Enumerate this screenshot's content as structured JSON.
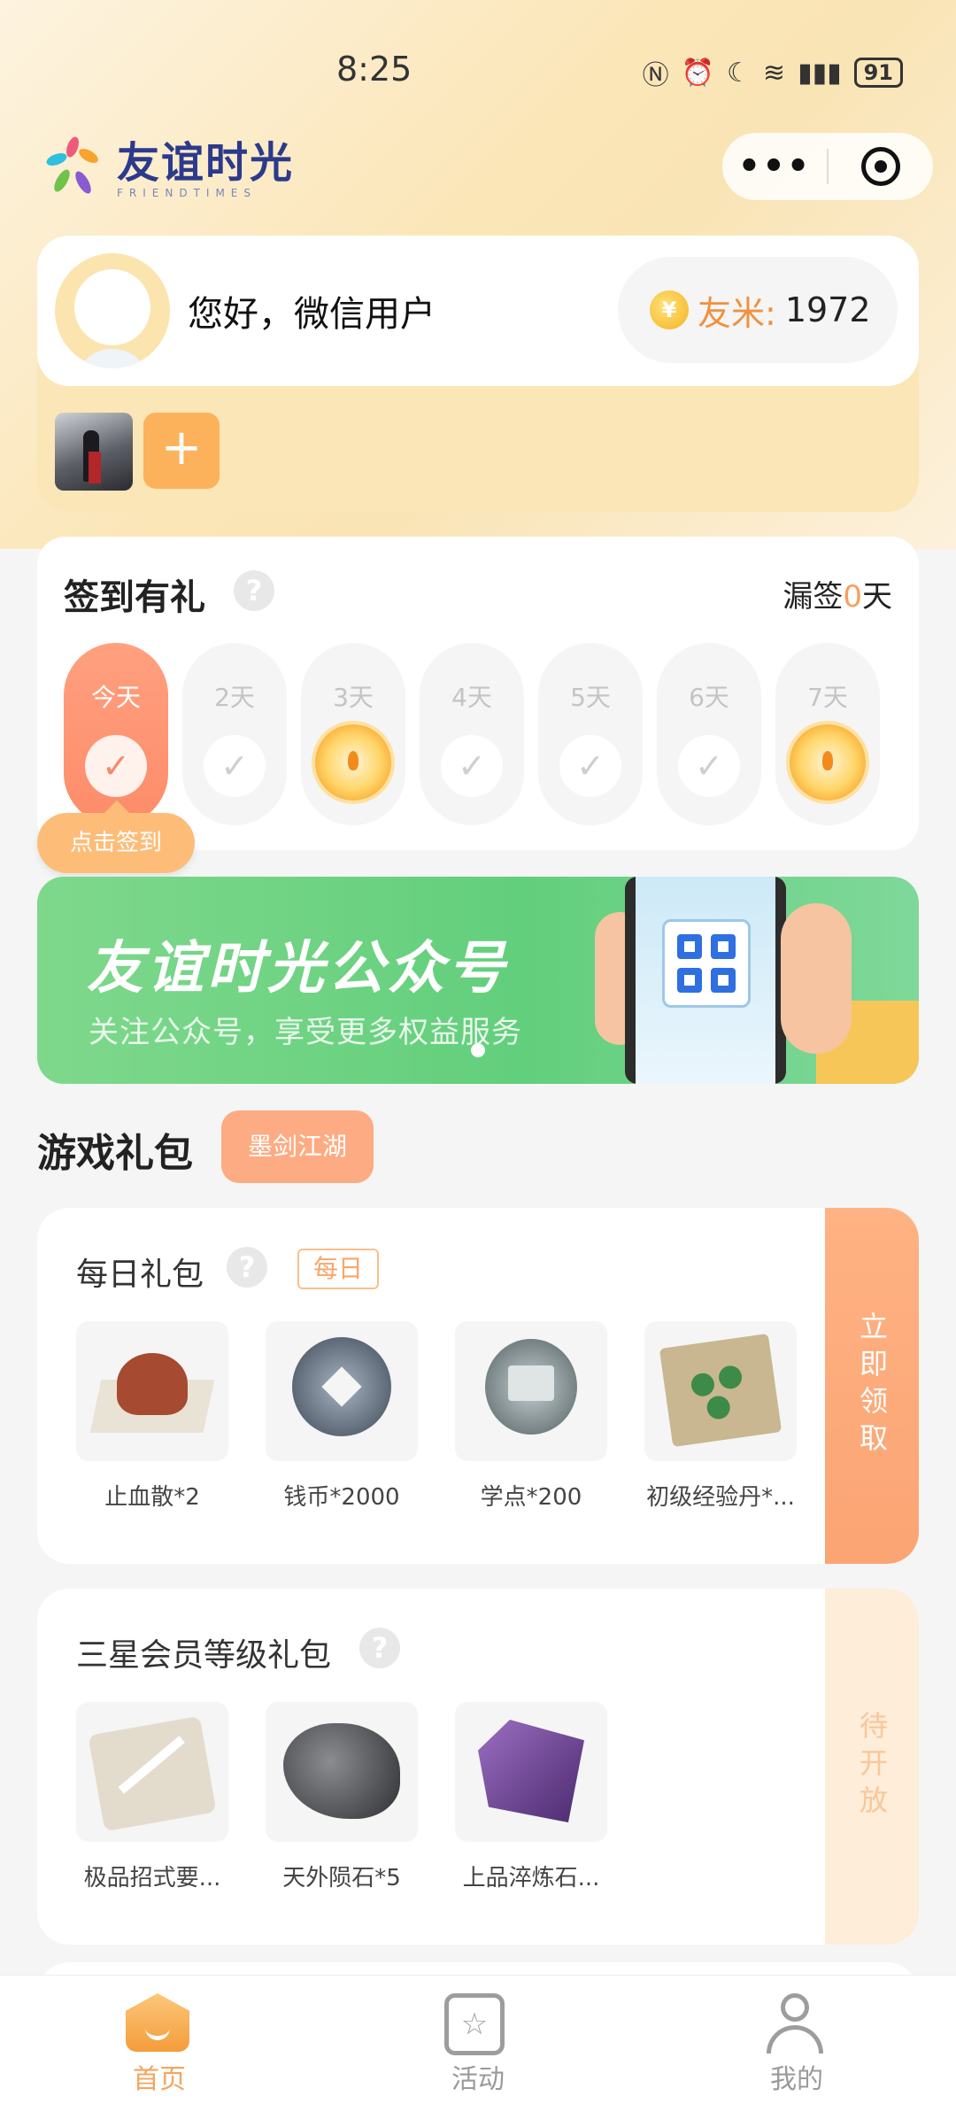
{
  "status_bar": {
    "time": "8:25",
    "icons": [
      "nfc-icon",
      "alarm-icon",
      "moon-icon",
      "wifi-icon",
      "signal-5g-icon"
    ],
    "battery": "91"
  },
  "header": {
    "logo_text": "友谊时光",
    "logo_sub": "FRIENDTIMES"
  },
  "user": {
    "greeting": "您好，微信用户",
    "coin_label": "友米:",
    "coin_value": "1972"
  },
  "signin": {
    "title": "签到有礼",
    "missed_prefix": "漏签",
    "missed_count": "0",
    "missed_suffix": "天",
    "days": [
      {
        "label": "今天",
        "state": "today"
      },
      {
        "label": "2天",
        "state": "check"
      },
      {
        "label": "3天",
        "state": "prize"
      },
      {
        "label": "4天",
        "state": "check"
      },
      {
        "label": "5天",
        "state": "check"
      },
      {
        "label": "6天",
        "state": "check"
      },
      {
        "label": "7天",
        "state": "prize"
      }
    ],
    "tip": "点击签到"
  },
  "banner": {
    "title": "友谊时光公众号",
    "subtitle": "关注公众号，享受更多权益服务"
  },
  "gifts": {
    "section_title": "游戏礼包",
    "game_chip": "墨剑江湖",
    "daily": {
      "title": "每日礼包",
      "tag": "每日",
      "action": "立即领取",
      "items": [
        {
          "name": "止血散*2"
        },
        {
          "name": "钱币*2000"
        },
        {
          "name": "学点*200"
        },
        {
          "name": "初级经验丹*..."
        }
      ]
    },
    "member": {
      "title": "三星会员等级礼包",
      "action": "待开放",
      "items": [
        {
          "name": "极品招式要..."
        },
        {
          "name": "天外陨石*5"
        },
        {
          "name": "上品淬炼石..."
        }
      ]
    }
  },
  "tabbar": {
    "tabs": [
      {
        "label": "首页",
        "active": true
      },
      {
        "label": "活动",
        "active": false
      },
      {
        "label": "我的",
        "active": false
      }
    ]
  },
  "colors": {
    "accent_orange": "#f5a45d",
    "today_coral": "#fd8c6a",
    "banner_green": "#62cf7c"
  }
}
